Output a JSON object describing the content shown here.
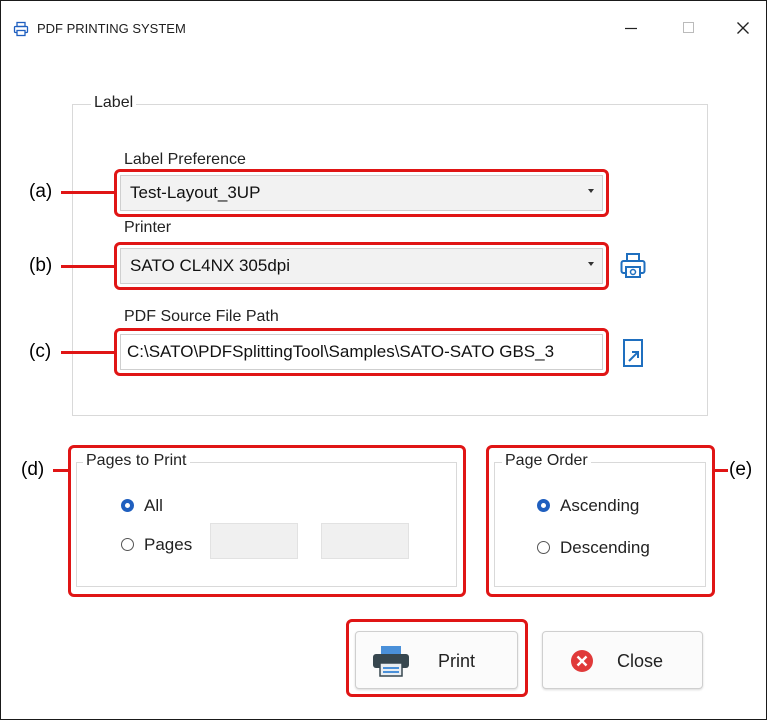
{
  "window": {
    "title": "PDF PRINTING SYSTEM",
    "icon": "printer-icon",
    "controls": [
      "minimize-icon",
      "maximize-icon",
      "close-icon"
    ]
  },
  "label_group": {
    "legend": "Label",
    "label_preference": {
      "label": "Label Preference",
      "value": "Test-Layout_3UP"
    },
    "printer": {
      "label": "Printer",
      "value": "SATO CL4NX 305dpi",
      "settings_icon": "printer-settings-icon"
    },
    "pdf_source": {
      "label": "PDF Source File Path",
      "value": "C:\\SATO\\PDFSplittingTool\\Samples\\SATO-SATO GBS_3",
      "browse_icon": "browse-file-icon"
    }
  },
  "pages_group": {
    "legend": "Pages to Print",
    "options": [
      {
        "label": "All",
        "selected": true
      },
      {
        "label": "Pages",
        "selected": false
      }
    ],
    "page_from": "",
    "page_to": ""
  },
  "order_group": {
    "legend": "Page Order",
    "options": [
      {
        "label": "Ascending",
        "selected": true
      },
      {
        "label": "Descending",
        "selected": false
      }
    ]
  },
  "buttons": {
    "print": {
      "label": "Print",
      "icon": "printer-icon"
    },
    "close": {
      "label": "Close",
      "icon": "close-circle-icon"
    }
  },
  "callouts": {
    "a": "(a)",
    "b": "(b)",
    "c": "(c)",
    "d": "(d)",
    "e": "(e)"
  },
  "colors": {
    "highlight": "#e01515",
    "accent": "#1f5fbf",
    "close_red": "#e03a3a"
  }
}
